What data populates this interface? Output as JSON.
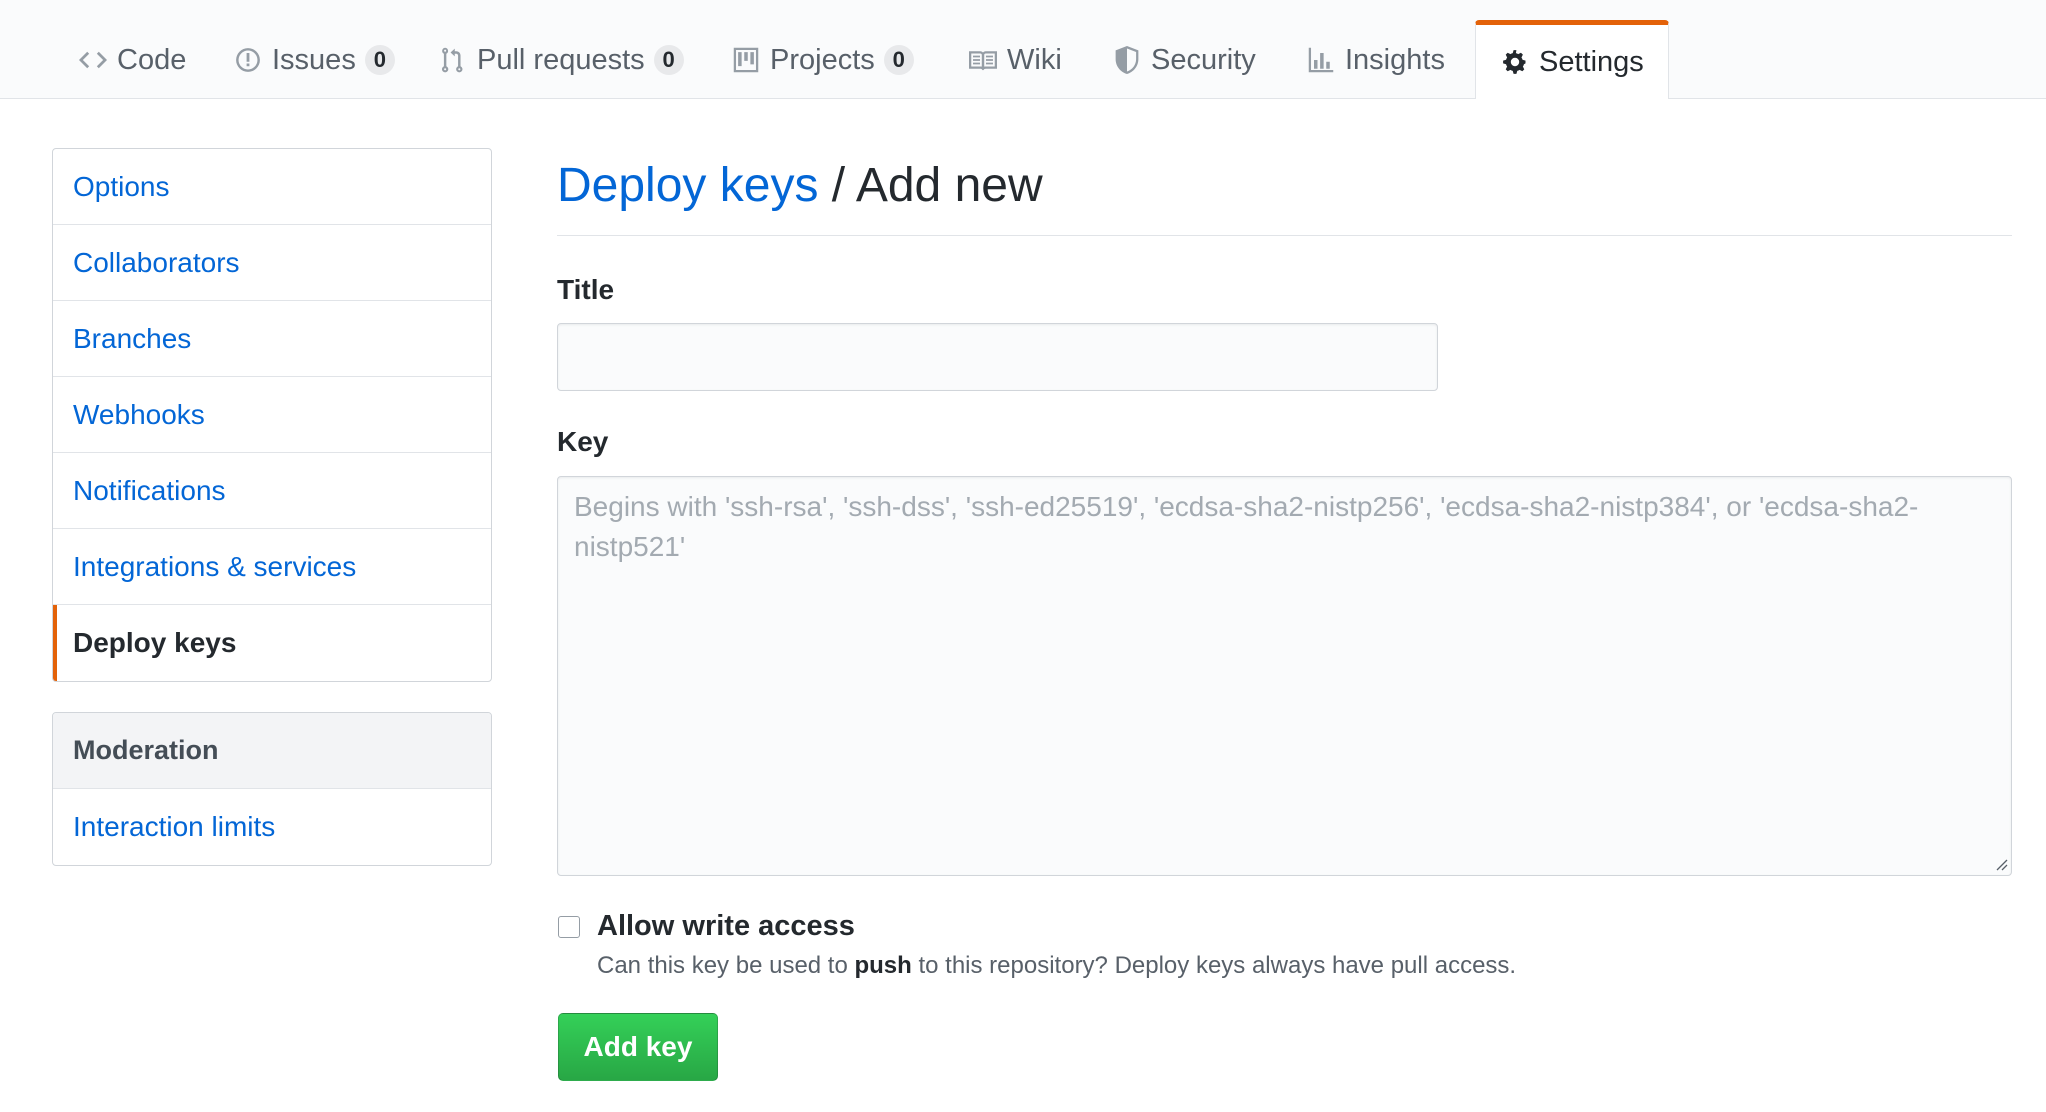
{
  "tabs": [
    {
      "label": "Code",
      "icon": "code-icon"
    },
    {
      "label": "Issues",
      "icon": "issue-icon",
      "count": "0"
    },
    {
      "label": "Pull requests",
      "icon": "pull-request-icon",
      "count": "0"
    },
    {
      "label": "Projects",
      "icon": "project-icon",
      "count": "0"
    },
    {
      "label": "Wiki",
      "icon": "book-icon"
    },
    {
      "label": "Security",
      "icon": "shield-icon"
    },
    {
      "label": "Insights",
      "icon": "graph-icon"
    },
    {
      "label": "Settings",
      "icon": "gear-icon",
      "selected": true
    }
  ],
  "sidebar": {
    "items": [
      {
        "label": "Options"
      },
      {
        "label": "Collaborators"
      },
      {
        "label": "Branches"
      },
      {
        "label": "Webhooks"
      },
      {
        "label": "Notifications"
      },
      {
        "label": "Integrations & services"
      },
      {
        "label": "Deploy keys",
        "selected": true
      }
    ],
    "moderation": {
      "heading": "Moderation",
      "items": [
        {
          "label": "Interaction limits"
        }
      ]
    }
  },
  "main": {
    "breadcrumb_link": "Deploy keys",
    "breadcrumb_rest": "/ Add new",
    "title_label": "Title",
    "title_value": "",
    "key_label": "Key",
    "key_placeholder": "Begins with 'ssh-rsa', 'ssh-dss', 'ssh-ed25519', 'ecdsa-sha2-nistp256', 'ecdsa-sha2-nistp384', or 'ecdsa-sha2-nistp521'",
    "write_access": {
      "checked": false,
      "label": "Allow write access",
      "note_before": "Can this key be used to ",
      "note_bold": "push",
      "note_after": " to this repository? Deploy keys always have pull access."
    },
    "submit_label": "Add key"
  },
  "colors": {
    "accent": "#e36209",
    "link": "#0366d6",
    "primary_button": "#28a745"
  }
}
